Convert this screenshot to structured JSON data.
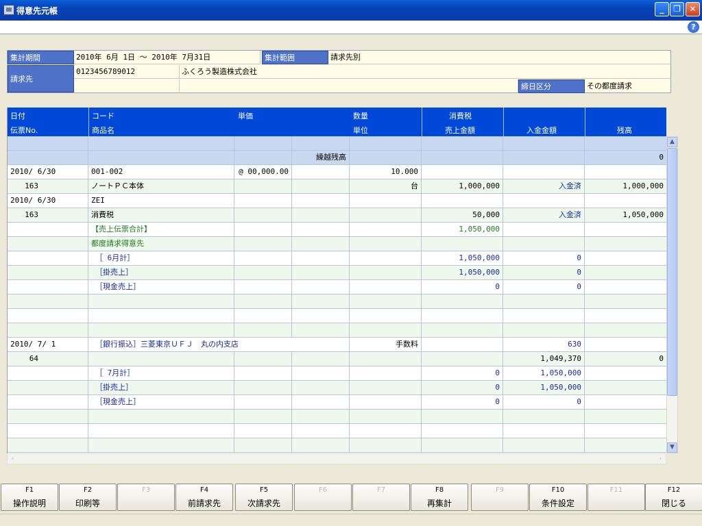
{
  "window": {
    "title": "得意先元帳"
  },
  "info": {
    "period_label": "集計期間",
    "period_value": "2010年 6月 1日 ～ 2010年 7月31日",
    "range_label": "集計範囲",
    "range_value": "請求先別",
    "billto_label": "請求先",
    "billto_code": "0123456789012",
    "billto_name": "ふくろう製造株式会社",
    "closing_label": "締日区分",
    "closing_value": "その都度請求"
  },
  "grid": {
    "headers": {
      "date": "日付",
      "slip": "伝票No.",
      "code": "コード",
      "product": "商品名",
      "price": "単価",
      "qty": "数量",
      "unit": "単位",
      "tax": "消費税",
      "sales": "売上金額",
      "payment": "入金金額",
      "balance": "残高"
    },
    "rows": [
      {
        "a": "",
        "b": "",
        "c": "",
        "d": "",
        "e": "",
        "f": "",
        "g": "",
        "h": ""
      },
      {
        "a": "",
        "b": "",
        "c": "",
        "d": "繰越残高",
        "e": "",
        "f": "",
        "g": "",
        "h": "0"
      },
      {
        "a": "2010/ 6/30",
        "b": "001-002",
        "c": "@ 00,000.00",
        "d": "",
        "e": "10.000",
        "f": "",
        "g": "",
        "h": ""
      },
      {
        "a": "163",
        "b": "ノートＰＣ本体",
        "c": "",
        "d": "",
        "e": "台",
        "f": "1,000,000",
        "g": "入金済",
        "h": "1,000,000"
      },
      {
        "a": "2010/ 6/30",
        "b": "ZEI",
        "c": "",
        "d": "",
        "e": "",
        "f": "",
        "g": "",
        "h": ""
      },
      {
        "a": "163",
        "b": "消費税",
        "c": "",
        "d": "",
        "e": "",
        "f": "50,000",
        "g": "入金済",
        "h": "1,050,000"
      },
      {
        "a": "",
        "b": "【売上伝票合計】",
        "c": "",
        "d": "",
        "e": "",
        "f": "1,050,000",
        "g": "",
        "h": ""
      },
      {
        "a": "",
        "b": "都度請求得意先",
        "c": "",
        "d": "",
        "e": "",
        "f": "",
        "g": "",
        "h": ""
      },
      {
        "a": "",
        "b": "［ 6月計］",
        "c": "",
        "d": "",
        "e": "",
        "f": "1,050,000",
        "g": "0",
        "h": ""
      },
      {
        "a": "",
        "b": "［掛売上］",
        "c": "",
        "d": "",
        "e": "",
        "f": "1,050,000",
        "g": "0",
        "h": ""
      },
      {
        "a": "",
        "b": "［現金売上］",
        "c": "",
        "d": "",
        "e": "",
        "f": "0",
        "g": "0",
        "h": ""
      },
      {
        "a": "",
        "b": "",
        "c": "",
        "d": "",
        "e": "",
        "f": "",
        "g": "",
        "h": ""
      },
      {
        "a": "",
        "b": "",
        "c": "",
        "d": "",
        "e": "",
        "f": "",
        "g": "",
        "h": ""
      },
      {
        "a": "",
        "b": "",
        "c": "",
        "d": "",
        "e": "",
        "f": "",
        "g": "",
        "h": ""
      },
      {
        "a": "2010/ 7/ 1",
        "b": "［銀行振込］三菱東京ＵＦＪ　丸の内支店",
        "c": "",
        "d": "",
        "e": "手数料",
        "f": "",
        "g": "630",
        "h": ""
      },
      {
        "a": "64",
        "b": "",
        "c": "",
        "d": "",
        "e": "",
        "f": "",
        "g": "1,049,370",
        "h": "0"
      },
      {
        "a": "",
        "b": "［ 7月計］",
        "c": "",
        "d": "",
        "e": "",
        "f": "0",
        "g": "1,050,000",
        "h": ""
      },
      {
        "a": "",
        "b": "［掛売上］",
        "c": "",
        "d": "",
        "e": "",
        "f": "0",
        "g": "1,050,000",
        "h": ""
      },
      {
        "a": "",
        "b": "［現金売上］",
        "c": "",
        "d": "",
        "e": "",
        "f": "0",
        "g": "0",
        "h": ""
      },
      {
        "a": "",
        "b": "",
        "c": "",
        "d": "",
        "e": "",
        "f": "",
        "g": "",
        "h": ""
      },
      {
        "a": "",
        "b": "",
        "c": "",
        "d": "",
        "e": "",
        "f": "",
        "g": "",
        "h": ""
      },
      {
        "a": "",
        "b": "",
        "c": "",
        "d": "",
        "e": "",
        "f": "",
        "g": "",
        "h": ""
      }
    ]
  },
  "fkeys": [
    {
      "key": "F1",
      "label": "操作説明",
      "enabled": true
    },
    {
      "key": "F2",
      "label": "印刷等",
      "enabled": true
    },
    {
      "key": "F3",
      "label": "",
      "enabled": false
    },
    {
      "key": "F4",
      "label": "前請求先",
      "enabled": true
    },
    {
      "key": "F5",
      "label": "次請求先",
      "enabled": true
    },
    {
      "key": "F6",
      "label": "",
      "enabled": false
    },
    {
      "key": "F7",
      "label": "",
      "enabled": false
    },
    {
      "key": "F8",
      "label": "再集計",
      "enabled": true
    },
    {
      "key": "F9",
      "label": "",
      "enabled": false
    },
    {
      "key": "F10",
      "label": "条件設定",
      "enabled": true
    },
    {
      "key": "F11",
      "label": "",
      "enabled": false
    },
    {
      "key": "F12",
      "label": "閉じる",
      "enabled": true
    }
  ],
  "icons": {
    "app": "ledger-app-icon",
    "help": "help-icon",
    "minimize": "minimize-icon",
    "restore": "restore-icon",
    "close": "close-icon",
    "scroll_up": "arrow-up-icon",
    "scroll_down": "arrow-down-icon",
    "scroll_left": "arrow-left-icon",
    "scroll_right": "arrow-right-icon"
  }
}
